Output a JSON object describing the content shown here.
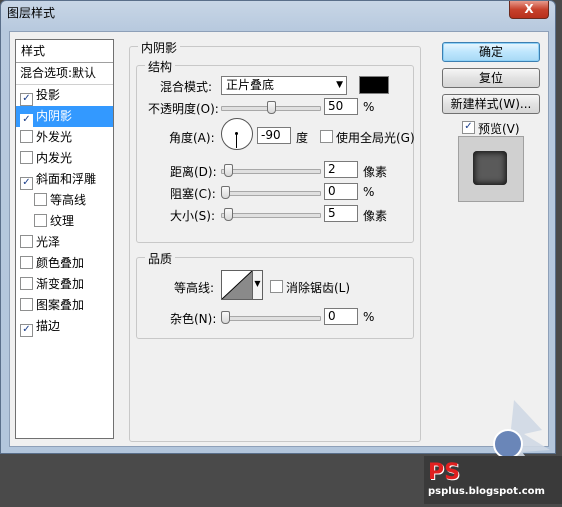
{
  "window": {
    "title": "图层样式",
    "close": "X"
  },
  "styles": {
    "header": "样式",
    "blend_options": "混合选项:默认",
    "items": [
      {
        "label": "投影",
        "checked": true,
        "indent": false,
        "selected": false
      },
      {
        "label": "内阴影",
        "checked": true,
        "indent": false,
        "selected": true
      },
      {
        "label": "外发光",
        "checked": false,
        "indent": false,
        "selected": false
      },
      {
        "label": "内发光",
        "checked": false,
        "indent": false,
        "selected": false
      },
      {
        "label": "斜面和浮雕",
        "checked": true,
        "indent": false,
        "selected": false
      },
      {
        "label": "等高线",
        "checked": false,
        "indent": true,
        "selected": false
      },
      {
        "label": "纹理",
        "checked": false,
        "indent": true,
        "selected": false
      },
      {
        "label": "光泽",
        "checked": false,
        "indent": false,
        "selected": false
      },
      {
        "label": "颜色叠加",
        "checked": false,
        "indent": false,
        "selected": false
      },
      {
        "label": "渐变叠加",
        "checked": false,
        "indent": false,
        "selected": false
      },
      {
        "label": "图案叠加",
        "checked": false,
        "indent": false,
        "selected": false
      },
      {
        "label": "描边",
        "checked": true,
        "indent": false,
        "selected": false
      }
    ]
  },
  "inner_shadow": {
    "title": "内阴影",
    "structure": {
      "title": "结构",
      "blend_mode_label": "混合模式:",
      "blend_mode_value": "正片叠底",
      "color": "#000000",
      "opacity_label": "不透明度(O):",
      "opacity_value": "50",
      "opacity_fraction": 0.5,
      "percent": "%",
      "angle_label": "角度(A):",
      "angle_value": "-90",
      "angle_unit": "度",
      "global_light_label": "使用全局光(G)",
      "global_light_checked": false,
      "distance_label": "距离(D):",
      "distance_value": "2",
      "distance_fraction": 0.03,
      "distance_unit": "像素",
      "choke_label": "阻塞(C):",
      "choke_value": "0",
      "choke_fraction": 0.0,
      "size_label": "大小(S):",
      "size_value": "5",
      "size_fraction": 0.03,
      "size_unit": "像素"
    },
    "quality": {
      "title": "品质",
      "contour_label": "等高线:",
      "antialias_label": "消除锯齿(L)",
      "antialias_checked": false,
      "noise_label": "杂色(N):",
      "noise_value": "0",
      "noise_fraction": 0.0,
      "percent": "%"
    }
  },
  "buttons": {
    "ok": "确定",
    "reset": "复位",
    "new_style": "新建样式(W)...",
    "preview_label": "预览(V)",
    "preview_checked": true
  },
  "watermark": {
    "line1": "PS",
    "line2": "psplus.blogspot.com"
  }
}
